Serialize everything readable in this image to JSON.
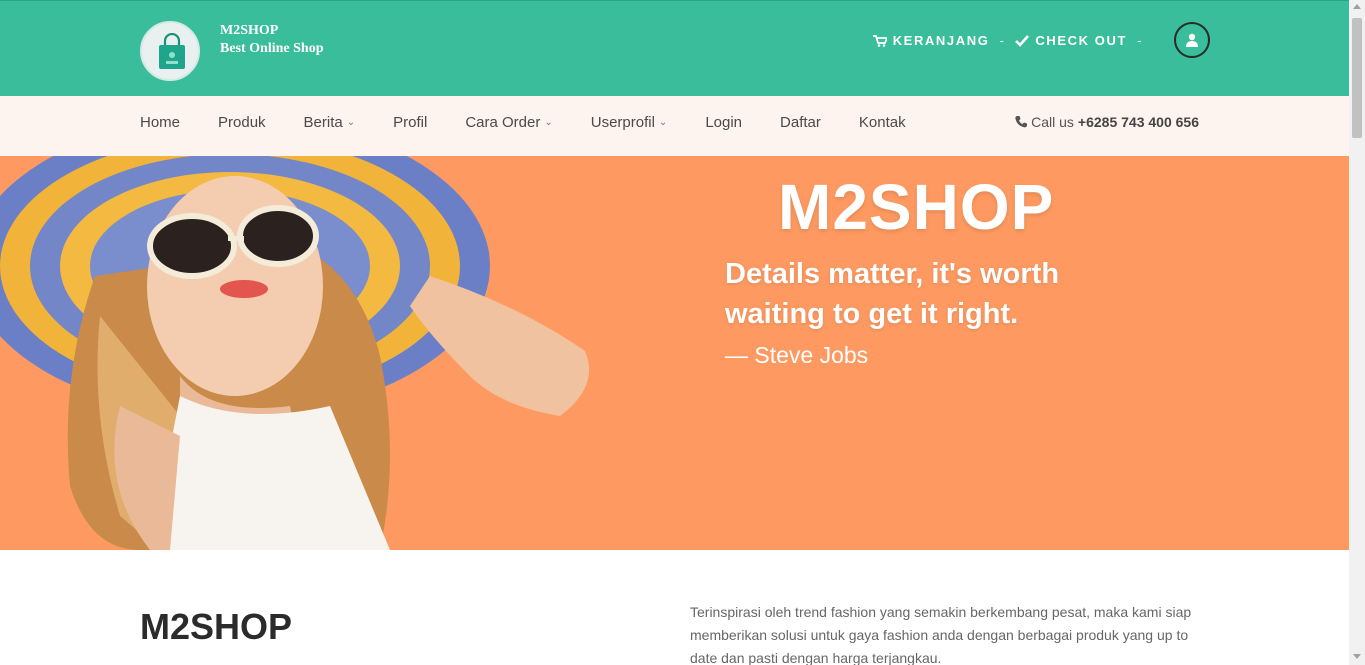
{
  "header": {
    "brand_name": "M2SHOP",
    "brand_tagline": "Best Online Shop",
    "logo_icon": "shopping-bag-icon",
    "cart_label": "KERANJANG",
    "separator": "-",
    "checkout_label": "CHECK OUT",
    "user_icon": "user-icon",
    "colors": {
      "header_bg": "#39bd9a",
      "nav_bg": "#fdf3ef",
      "hero_bg": "#fe9a61"
    }
  },
  "nav": {
    "items": [
      {
        "label": "Home",
        "dropdown": false
      },
      {
        "label": "Produk",
        "dropdown": false
      },
      {
        "label": "Berita",
        "dropdown": true
      },
      {
        "label": "Profil",
        "dropdown": false
      },
      {
        "label": "Cara Order",
        "dropdown": true
      },
      {
        "label": "Userprofil",
        "dropdown": true
      },
      {
        "label": "Login",
        "dropdown": false
      },
      {
        "label": "Daftar",
        "dropdown": false
      },
      {
        "label": "Kontak",
        "dropdown": false
      }
    ],
    "call_label": "Call us",
    "call_number": "+6285 743 400 656"
  },
  "hero": {
    "title": "M2SHOP",
    "quote": "Details matter, it's worth waiting to get it right.",
    "author": "— Steve Jobs"
  },
  "about": {
    "title": "M2SHOP",
    "text": "Terinspirasi oleh trend fashion yang semakin berkembang pesat, maka kami siap memberikan solusi untuk gaya fashion anda dengan berbagai produk yang up to date dan pasti dengan harga terjangkau."
  }
}
